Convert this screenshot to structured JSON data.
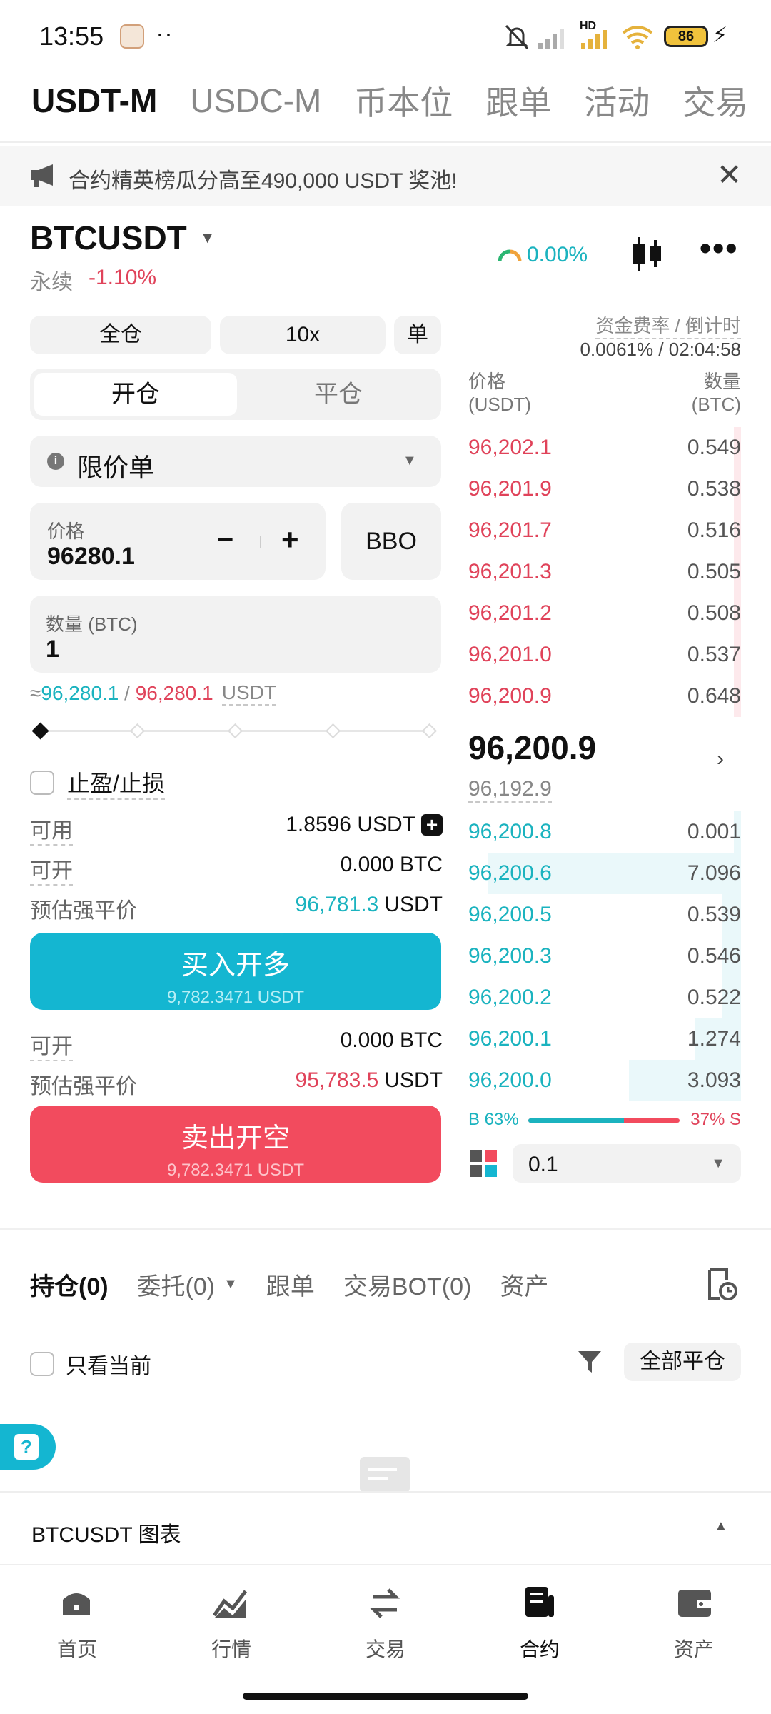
{
  "status_bar": {
    "time": "13:55",
    "dots": "··",
    "network": "HD",
    "battery": "86"
  },
  "top_tabs": [
    "USDT-M",
    "USDC-M",
    "币本位",
    "跟单",
    "活动",
    "交易"
  ],
  "banner": {
    "text": "合约精英榜瓜分高至490,000 USDT 奖池!"
  },
  "symbol": {
    "name": "BTCUSDT",
    "type": "永续",
    "change": "-1.10%",
    "funding_gauge": "0.00%"
  },
  "controls": {
    "margin_mode": "全仓",
    "leverage": "10x",
    "position_mode": "单"
  },
  "open_close": {
    "open": "开仓",
    "close": "平仓"
  },
  "order_type": {
    "label": "限价单"
  },
  "price_input": {
    "label": "价格",
    "value": "96280.1",
    "minus": "−",
    "plus": "+",
    "bbo": "BBO"
  },
  "qty_input": {
    "label": "数量 (BTC)",
    "value": "1"
  },
  "cost": {
    "prefix": "≈",
    "green": "96,280.1",
    "sep": " / ",
    "red": "96,280.1",
    "unit": "USDT"
  },
  "tpsl": {
    "label": "止盈/止损"
  },
  "account": {
    "avail_label": "可用",
    "avail_value": "1.8596 USDT",
    "open_label": "可开",
    "open_value": "0.000 BTC",
    "liq_label": "预估强平价",
    "liq_long_value": "96,781.3",
    "liq_unit": "USDT",
    "open2_value": "0.000 BTC",
    "liq_short_value": "95,783.5"
  },
  "buttons": {
    "buy_label": "买入开多",
    "buy_sub": "9,782.3471 USDT",
    "sell_label": "卖出开空",
    "sell_sub": "9,782.3471 USDT"
  },
  "funding": {
    "label": "资金费率 / 倒计时",
    "value": "0.0061% / 02:04:58"
  },
  "orderbook": {
    "price_header": "价格",
    "price_unit": "(USDT)",
    "qty_header": "数量",
    "qty_unit": "(BTC)",
    "asks": [
      {
        "price": "96,202.1",
        "qty": "0.549"
      },
      {
        "price": "96,201.9",
        "qty": "0.538"
      },
      {
        "price": "96,201.7",
        "qty": "0.516"
      },
      {
        "price": "96,201.3",
        "qty": "0.505"
      },
      {
        "price": "96,201.2",
        "qty": "0.508"
      },
      {
        "price": "96,201.0",
        "qty": "0.537"
      },
      {
        "price": "96,200.9",
        "qty": "0.648"
      }
    ],
    "last_price": "96,200.9",
    "mark_price": "96,192.9",
    "bids": [
      {
        "price": "96,200.8",
        "qty": "0.001",
        "depth": 0.0
      },
      {
        "price": "96,200.6",
        "qty": "7.096",
        "depth": 0.93
      },
      {
        "price": "96,200.5",
        "qty": "0.539",
        "depth": 0.07
      },
      {
        "price": "96,200.3",
        "qty": "0.546",
        "depth": 0.07
      },
      {
        "price": "96,200.2",
        "qty": "0.522",
        "depth": 0.07
      },
      {
        "price": "96,200.1",
        "qty": "1.274",
        "depth": 0.17
      },
      {
        "price": "96,200.0",
        "qty": "3.093",
        "depth": 0.41
      }
    ],
    "buy_ratio": "B 63%",
    "sell_ratio": "37% S",
    "buy_fraction": 0.63,
    "precision": "0.1"
  },
  "bottom_tabs": [
    "持仓(0)",
    "委托(0)",
    "跟单",
    "交易BOT(0)",
    "资产"
  ],
  "filter": {
    "only_current": "只看当前",
    "close_all": "全部平仓"
  },
  "chart_bar": {
    "label": "BTCUSDT 图表"
  },
  "nav": [
    "首页",
    "行情",
    "交易",
    "合约",
    "资产"
  ],
  "colors": {
    "green": "#1bb3bf",
    "red": "#e0435a",
    "buy_button": "#14b6d1",
    "sell_button": "#f24b5e"
  }
}
